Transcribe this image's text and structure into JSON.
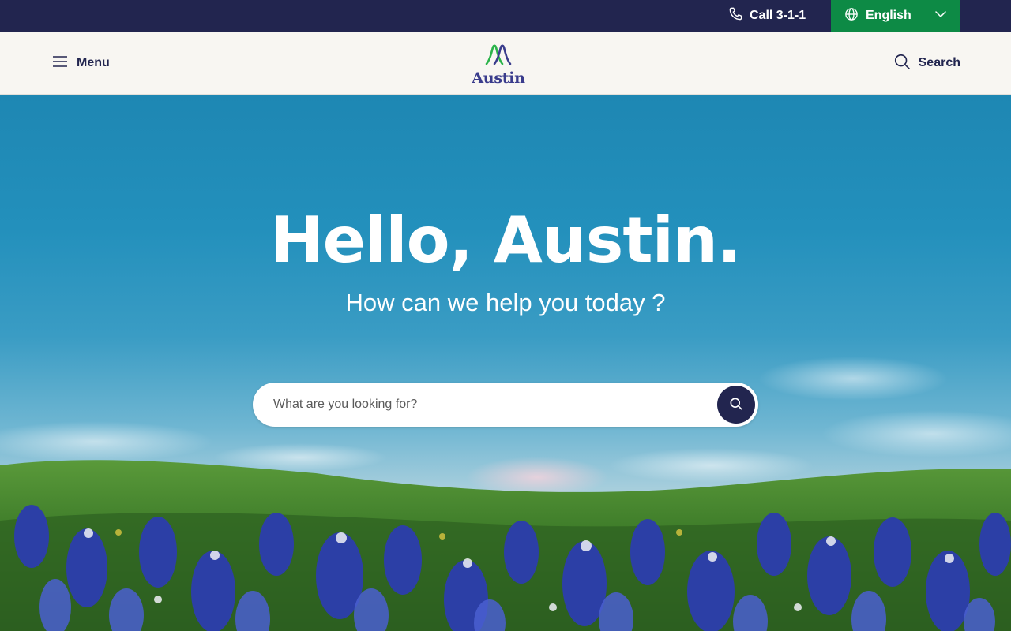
{
  "colors": {
    "utility_bar": "#22254f",
    "language_button": "#0d8a45",
    "header_bg": "#f8f6f2",
    "brand_navy": "#22254f",
    "logo_purple": "#3a3c8c",
    "logo_green": "#2bb34a"
  },
  "utility": {
    "call_label": "Call 3-1-1",
    "call_icon": "phone-icon",
    "language": {
      "selected": "English",
      "icon": "globe-icon",
      "chevron": "chevron-down-icon"
    }
  },
  "header": {
    "menu_label": "Menu",
    "menu_icon": "hamburger-icon",
    "logo_text": "Austin",
    "search_label": "Search",
    "search_icon": "search-icon"
  },
  "hero": {
    "title": "Hello, Austin.",
    "subtitle": "How can we help you today ?",
    "search": {
      "placeholder": "What are you looking for?",
      "value": "",
      "submit_icon": "search-icon"
    }
  }
}
